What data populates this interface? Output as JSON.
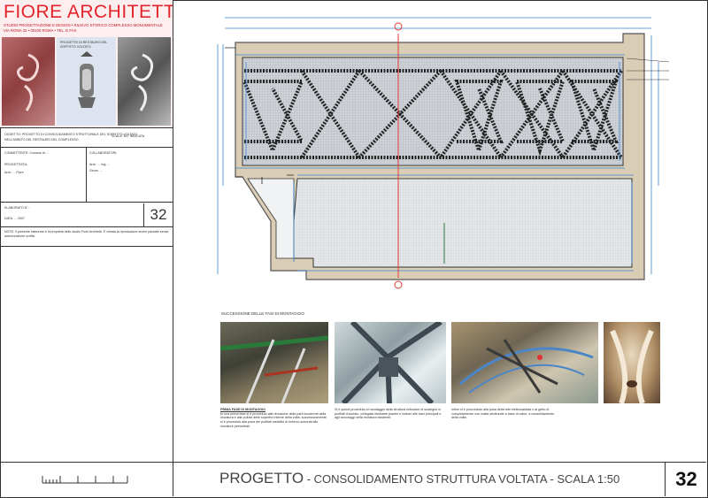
{
  "brand": {
    "title": "FIORE ARCHITETTI",
    "subtitle1": "STUDIO PROGETTAZIONE E DESIGN • RILIEVO STORICO COMPLESSO MONUMENTALE",
    "subtitle2": "VIA ROMA 32 • 00100 ROMA • TEL. E FAX"
  },
  "photo_caption": "PROGETTO DI RESTAURO DEL SOFFITTO VOLTATO",
  "info": {
    "project_line1": "OGGETTO: PROGETTO DI CONSOLIDAMENTO STRUTTURALE DEL SOFFITTO VOLTATO",
    "project_line2": "NELL'AMBITO DEL RESTAURO DEL COMPLESSO",
    "project_right": "SCALA \"AS\" INDICATA",
    "client_label": "COMMITTENTE: Comune di ...",
    "designer_label": "PROGETTISTA:",
    "designer_name": "Arch. ... Fiore",
    "collab_label": "COLLABORATORI:",
    "collab_1": "Arch. ...  Ing. ...",
    "collab_2": "Geom. ...",
    "date_label": "ELABORATO N°:",
    "date_value": "DATA: ... 2007",
    "notes": "NOTE: Il presente elaborato è di proprietà dello studio Fiore Architetti. È vietata la riproduzione anche parziale senza autorizzazione scritta."
  },
  "sheet_number": "32",
  "title_bar": {
    "main": "PROGETTO",
    "rest": " - CONSOLIDAMENTO STRUTTURA VOLTATA - SCALA 1:50",
    "number": "32"
  },
  "photos_caption": "SUCCESSIONE DELLE FASI DI MONTAGGIO",
  "photo_texts": [
    {
      "head": "PRIMA FASE DI MONTAGGIO",
      "body": "In una prima fase si è proceduto alla rimozione delle parti incoerenti della muratura e alla pulizia delle superfici interne della volta, successivamente si è proceduto alla posa dei profilati metallici di rinforzo ancorati alle murature perimetrali."
    },
    {
      "head": "",
      "body": "Si è quindi proceduto al montaggio della struttura reticolare di sostegno in profilati d'acciaio, collegata mediante piastre e bulloni alle travi principali e agli ancoraggi nella muratura esistente."
    },
    {
      "head": "",
      "body": "Infine si è provveduto alla posa della rete elettrosaldata e al getto di completamento con malta strutturale a base di calce, a consolidamento della volta."
    }
  ]
}
